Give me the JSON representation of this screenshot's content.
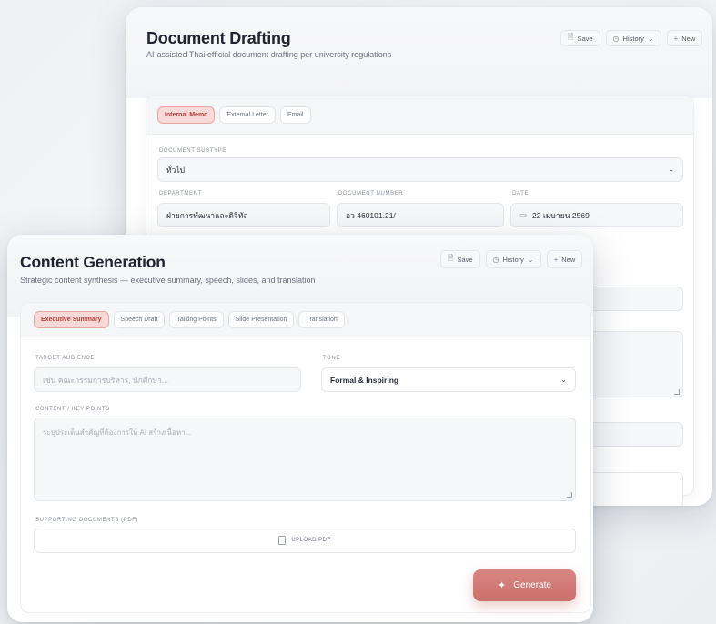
{
  "drafting": {
    "title": "Document Drafting",
    "subtitle": "AI-assisted Thai official document drafting per university regulations",
    "header_buttons": {
      "save": "Save",
      "history": "History",
      "new": "New"
    },
    "tabs": [
      "Internal Memo",
      "External Letter",
      "Email"
    ],
    "active_tab": "Internal Memo",
    "subtype_label": "DOCUMENT SUBTYPE",
    "subtype_value": "ทั่วไป",
    "department_label": "DEPARTMENT",
    "department_value": "ฝ่ายการพัฒนาและดิจิทัล",
    "docnum_label": "DOCUMENT NUMBER",
    "docnum_value": "อว 460101.21/",
    "date_label": "DATE",
    "date_value": "22 เมษายน 2569"
  },
  "generation": {
    "title": "Content Generation",
    "subtitle": "Strategic content synthesis — executive summary, speech, slides, and translation",
    "header_buttons": {
      "save": "Save",
      "history": "History",
      "new": "New"
    },
    "tabs": [
      "Executive Summary",
      "Speech Draft",
      "Talking Points",
      "Slide Presentation",
      "Translation"
    ],
    "active_tab": "Executive Summary",
    "audience_label": "TARGET AUDIENCE",
    "audience_placeholder": "เช่น คณะกรรมการบริหาร, นักศึกษา...",
    "tone_label": "TONE",
    "tone_value": "Formal & Inspiring",
    "content_label": "CONTENT / KEY POINTS",
    "content_placeholder": "ระบุประเด็นสำคัญที่ต้องการให้ AI สร้างเนื้อหา...",
    "docs_label": "SUPPORTING DOCUMENTS (PDF)",
    "upload_label": "UPLOAD PDF",
    "generate_label": "Generate"
  },
  "colors": {
    "accent": "#cc6f6a",
    "active_tab_bg": "#f7d9d7",
    "active_tab_text": "#b4403a"
  },
  "icons": [
    "save-icon",
    "history-icon",
    "plus-icon",
    "chevron-down-icon",
    "calendar-icon",
    "file-icon",
    "sparkle-icon"
  ]
}
